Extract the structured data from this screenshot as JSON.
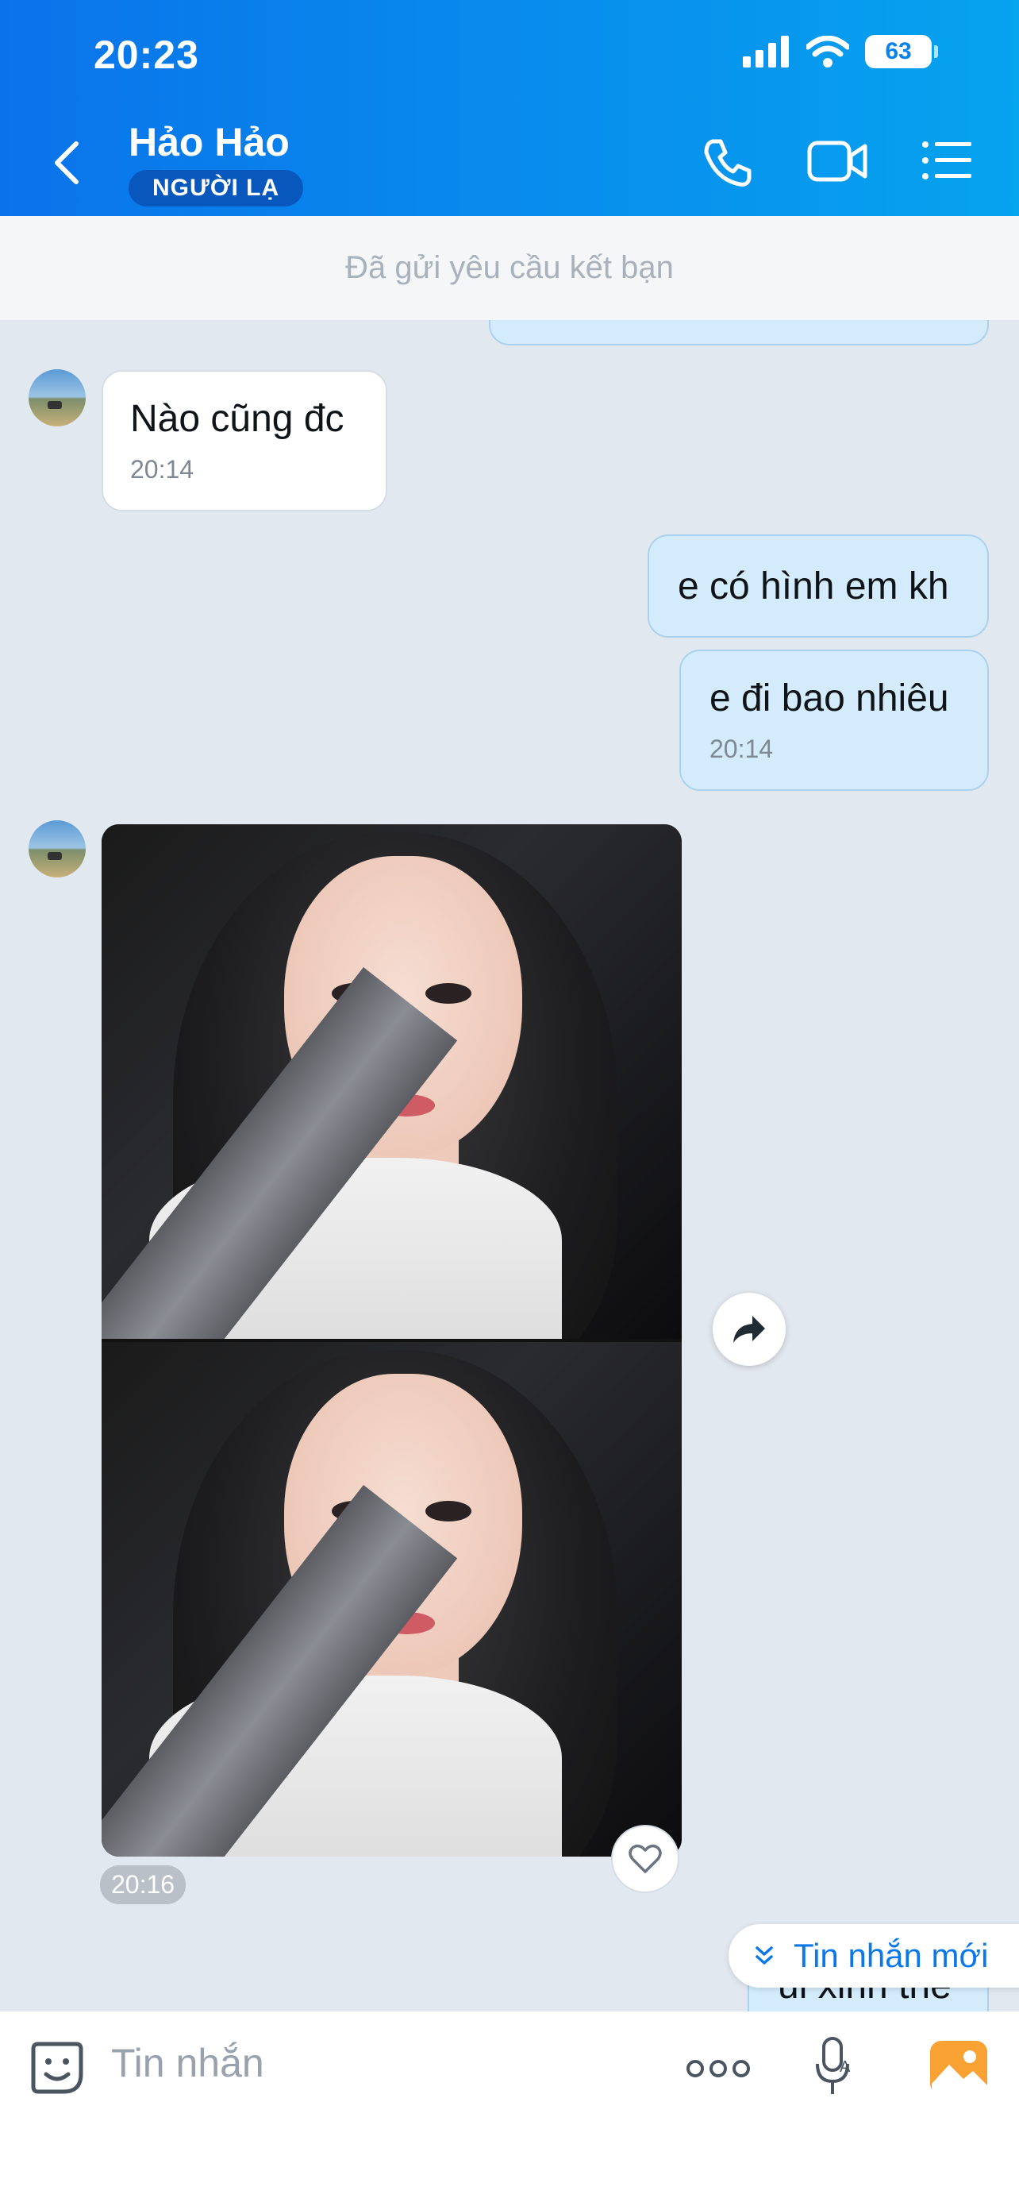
{
  "status_bar": {
    "time": "20:23",
    "battery": "63"
  },
  "header": {
    "name": "Hảo Hảo",
    "badge": "NGƯỜI LẠ"
  },
  "friend_request": "Đã gửi yêu cầu kết bạn",
  "messages": [
    {
      "text": "Nào cũng đc",
      "time": "20:14"
    },
    {
      "text": "e có hình em kh"
    },
    {
      "text": "e đi bao nhiêu",
      "time": "20:14"
    },
    {
      "time": "20:16"
    },
    {
      "text": "ui xinh thế"
    }
  ],
  "new_messages_label": "Tin nhắn mới",
  "input": {
    "placeholder": "Tin nhắn"
  },
  "colors": {
    "header_start": "#0a73ea",
    "header_end": "#06a3ef",
    "outgoing_bubble": "#d3ebfb",
    "accent": "#0a78ea"
  }
}
